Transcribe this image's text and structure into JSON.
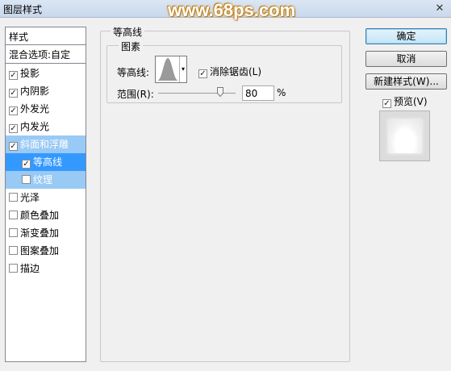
{
  "window": {
    "title": "图层样式",
    "watermark": "www.68ps.com",
    "close_icon": "close-icon"
  },
  "styles": {
    "header": "样式",
    "blend_options": "混合选项:自定",
    "items": [
      {
        "label": "投影",
        "checked": true
      },
      {
        "label": "内阴影",
        "checked": true
      },
      {
        "label": "外发光",
        "checked": true
      },
      {
        "label": "内发光",
        "checked": true
      },
      {
        "label": "斜面和浮雕",
        "checked": true
      },
      {
        "label": "等高线",
        "checked": true
      },
      {
        "label": "纹理",
        "checked": false
      },
      {
        "label": "光泽",
        "checked": false
      },
      {
        "label": "颜色叠加",
        "checked": false
      },
      {
        "label": "渐变叠加",
        "checked": false
      },
      {
        "label": "图案叠加",
        "checked": false
      },
      {
        "label": "描边",
        "checked": false
      }
    ]
  },
  "contour_panel": {
    "group_title": "等高线",
    "sub_group_title": "图素",
    "contour_label": "等高线:",
    "antialias_label": "消除锯齿(L)",
    "antialias_checked": true,
    "range_label": "范围(R):",
    "range_value": "80",
    "range_unit": "%"
  },
  "buttons": {
    "ok": "确定",
    "cancel": "取消",
    "new_style": "新建样式(W)...",
    "preview_label": "预览(V)",
    "preview_checked": true
  },
  "colors": {
    "selected_row": "#3399ff",
    "sub_selected_row": "#99c9f5",
    "watermark_outline": "#c98a1e"
  }
}
